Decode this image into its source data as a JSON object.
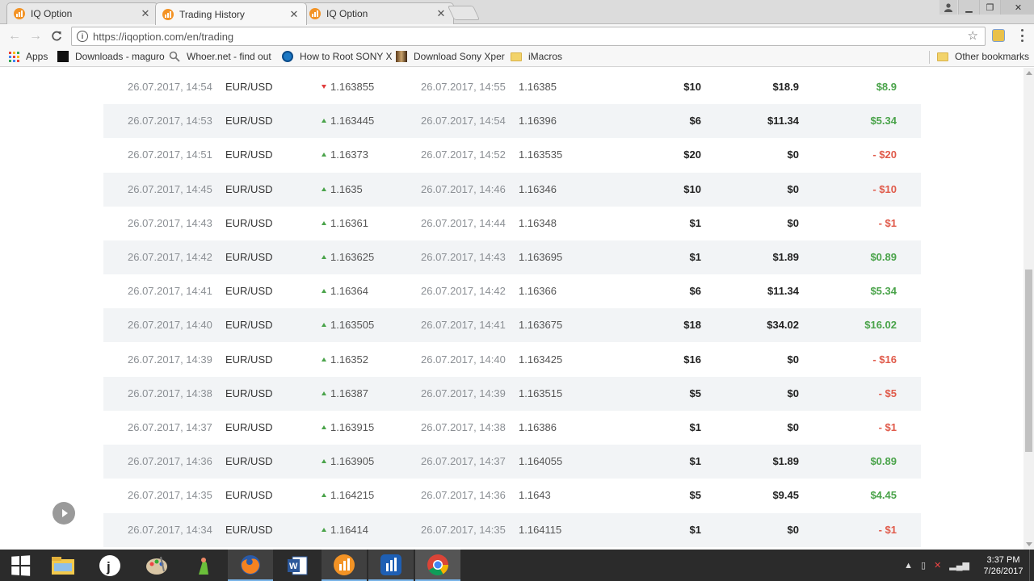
{
  "browser": {
    "tabs": [
      {
        "label": "IQ Option",
        "active": false
      },
      {
        "label": "Trading History",
        "active": true
      },
      {
        "label": "IQ Option",
        "active": false
      }
    ],
    "url": "https://iqoption.com/en/trading",
    "bookmarks": [
      {
        "label": "Apps",
        "icon": "apps-grid-icon"
      },
      {
        "label": "Downloads - maguro",
        "icon": "black-square-icon"
      },
      {
        "label": "Whoer.net - find out",
        "icon": "search-icon"
      },
      {
        "label": "How to Root SONY X",
        "icon": "blue-circle-icon"
      },
      {
        "label": "Download Sony Xper",
        "icon": "image-icon"
      },
      {
        "label": "iMacros",
        "icon": "folder-icon"
      }
    ],
    "other_bookmarks": "Other bookmarks"
  },
  "colors": {
    "profit_positive": "#4aa34a",
    "profit_negative": "#e05a4a",
    "arrow_up": "#4aa34a",
    "arrow_down": "#e03b3b",
    "row_alt": "#f2f4f6"
  },
  "trades": [
    {
      "open_time": "26.07.2017, 14:54",
      "asset": "EUR/USD",
      "direction": "down",
      "open_price": "1.163855",
      "close_time": "26.07.2017, 14:55",
      "close_price": "1.16385",
      "investment": "$10",
      "payout": "$18.9",
      "profit": "$8.9",
      "profit_sign": "pos"
    },
    {
      "open_time": "26.07.2017, 14:53",
      "asset": "EUR/USD",
      "direction": "up",
      "open_price": "1.163445",
      "close_time": "26.07.2017, 14:54",
      "close_price": "1.16396",
      "investment": "$6",
      "payout": "$11.34",
      "profit": "$5.34",
      "profit_sign": "pos"
    },
    {
      "open_time": "26.07.2017, 14:51",
      "asset": "EUR/USD",
      "direction": "up",
      "open_price": "1.16373",
      "close_time": "26.07.2017, 14:52",
      "close_price": "1.163535",
      "investment": "$20",
      "payout": "$0",
      "profit": "- $20",
      "profit_sign": "neg"
    },
    {
      "open_time": "26.07.2017, 14:45",
      "asset": "EUR/USD",
      "direction": "up",
      "open_price": "1.1635",
      "close_time": "26.07.2017, 14:46",
      "close_price": "1.16346",
      "investment": "$10",
      "payout": "$0",
      "profit": "- $10",
      "profit_sign": "neg"
    },
    {
      "open_time": "26.07.2017, 14:43",
      "asset": "EUR/USD",
      "direction": "up",
      "open_price": "1.16361",
      "close_time": "26.07.2017, 14:44",
      "close_price": "1.16348",
      "investment": "$1",
      "payout": "$0",
      "profit": "- $1",
      "profit_sign": "neg"
    },
    {
      "open_time": "26.07.2017, 14:42",
      "asset": "EUR/USD",
      "direction": "up",
      "open_price": "1.163625",
      "close_time": "26.07.2017, 14:43",
      "close_price": "1.163695",
      "investment": "$1",
      "payout": "$1.89",
      "profit": "$0.89",
      "profit_sign": "pos"
    },
    {
      "open_time": "26.07.2017, 14:41",
      "asset": "EUR/USD",
      "direction": "up",
      "open_price": "1.16364",
      "close_time": "26.07.2017, 14:42",
      "close_price": "1.16366",
      "investment": "$6",
      "payout": "$11.34",
      "profit": "$5.34",
      "profit_sign": "pos"
    },
    {
      "open_time": "26.07.2017, 14:40",
      "asset": "EUR/USD",
      "direction": "up",
      "open_price": "1.163505",
      "close_time": "26.07.2017, 14:41",
      "close_price": "1.163675",
      "investment": "$18",
      "payout": "$34.02",
      "profit": "$16.02",
      "profit_sign": "pos"
    },
    {
      "open_time": "26.07.2017, 14:39",
      "asset": "EUR/USD",
      "direction": "up",
      "open_price": "1.16352",
      "close_time": "26.07.2017, 14:40",
      "close_price": "1.163425",
      "investment": "$16",
      "payout": "$0",
      "profit": "- $16",
      "profit_sign": "neg"
    },
    {
      "open_time": "26.07.2017, 14:38",
      "asset": "EUR/USD",
      "direction": "up",
      "open_price": "1.16387",
      "close_time": "26.07.2017, 14:39",
      "close_price": "1.163515",
      "investment": "$5",
      "payout": "$0",
      "profit": "- $5",
      "profit_sign": "neg"
    },
    {
      "open_time": "26.07.2017, 14:37",
      "asset": "EUR/USD",
      "direction": "up",
      "open_price": "1.163915",
      "close_time": "26.07.2017, 14:38",
      "close_price": "1.16386",
      "investment": "$1",
      "payout": "$0",
      "profit": "- $1",
      "profit_sign": "neg"
    },
    {
      "open_time": "26.07.2017, 14:36",
      "asset": "EUR/USD",
      "direction": "up",
      "open_price": "1.163905",
      "close_time": "26.07.2017, 14:37",
      "close_price": "1.164055",
      "investment": "$1",
      "payout": "$1.89",
      "profit": "$0.89",
      "profit_sign": "pos"
    },
    {
      "open_time": "26.07.2017, 14:35",
      "asset": "EUR/USD",
      "direction": "up",
      "open_price": "1.164215",
      "close_time": "26.07.2017, 14:36",
      "close_price": "1.1643",
      "investment": "$5",
      "payout": "$9.45",
      "profit": "$4.45",
      "profit_sign": "pos"
    },
    {
      "open_time": "26.07.2017, 14:34",
      "asset": "EUR/USD",
      "direction": "up",
      "open_price": "1.16414",
      "close_time": "26.07.2017, 14:35",
      "close_price": "1.164115",
      "investment": "$1",
      "payout": "$0",
      "profit": "- $1",
      "profit_sign": "neg"
    }
  ],
  "taskbar": {
    "time": "3:37 PM",
    "date": "7/26/2017",
    "apps": [
      "start-button",
      "file-explorer",
      "jdownloader",
      "paint",
      "greenshot",
      "firefox",
      "word",
      "iq-option",
      "iq-option-alt",
      "chrome"
    ]
  }
}
